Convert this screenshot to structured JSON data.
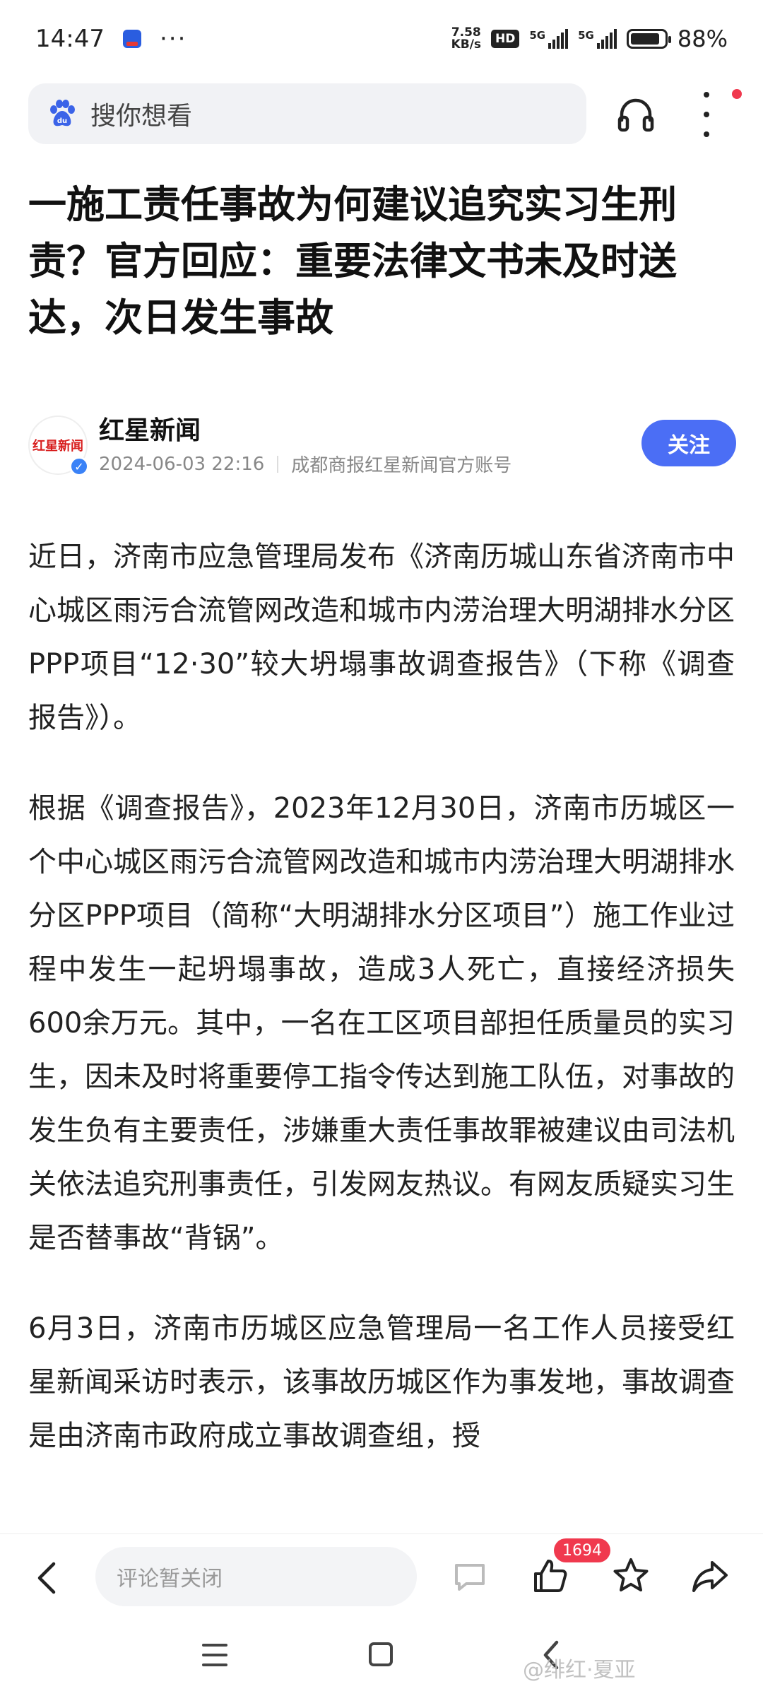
{
  "status_bar": {
    "time": "14:47",
    "more": "···",
    "net_speed_value": "7.58",
    "net_speed_unit": "KB/s",
    "hd": "HD",
    "signal1_label": "5G",
    "signal2_label": "5G",
    "battery_percent": "88%",
    "battery_level": 0.88
  },
  "search": {
    "placeholder": "搜你想看"
  },
  "article": {
    "title": "一施工责任事故为何建议追究实习生刑责？官方回应：重要法律文书未及时送达，次日发生事故",
    "author": {
      "avatar_text": "红星新闻",
      "name": "红星新闻",
      "datetime": "2024-06-03 22:16",
      "account": "成都商报红星新闻官方账号",
      "follow_label": "关注"
    },
    "paragraphs": [
      "近日，济南市应急管理局发布《济南历城山东省济南市中心城区雨污合流管网改造和城市内涝治理大明湖排水分区PPP项目“12·30”较大坍塌事故调查报告》（下称《调查报告》）。",
      "根据《调查报告》，2023年12月30日，济南市历城区一个中心城区雨污合流管网改造和城市内涝治理大明湖排水分区PPP项目（简称“大明湖排水分区项目”）施工作业过程中发生一起坍塌事故，造成3人死亡，直接经济损失600余万元。其中，一名在工区项目部担任质量员的实习生，因未及时将重要停工指令传达到施工队伍，对事故的发生负有主要责任，涉嫌重大责任事故罪被建议由司法机关依法追究刑事责任，引发网友热议。有网友质疑实习生是否替事故“背锅”。",
      "6月3日，济南市历城区应急管理局一名工作人员接受红星新闻采访时表示，该事故历城区作为事发地，事故调查是由济南市政府成立事故调查组，授"
    ]
  },
  "bottom_bar": {
    "comment_placeholder": "评论暂关闭",
    "like_count": "1694"
  },
  "watermark": "@绯红·夏亚",
  "colors": {
    "follow_button": "#4b6ef5",
    "badge_red": "#f0394e"
  }
}
